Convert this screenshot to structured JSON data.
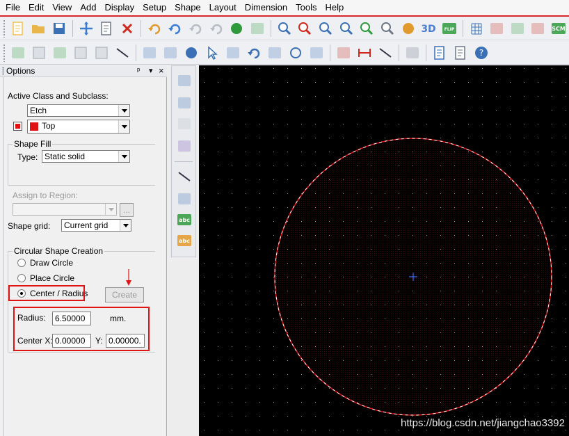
{
  "menu": [
    "File",
    "Edit",
    "View",
    "Add",
    "Display",
    "Setup",
    "Shape",
    "Layout",
    "Dimension",
    "Tools",
    "Help"
  ],
  "toolbar1": [
    {
      "icon": "new-file-icon",
      "color": "#f2c14e"
    },
    {
      "icon": "open-folder-icon",
      "color": "#e8b64a"
    },
    {
      "icon": "save-icon",
      "color": "#3b6fb6"
    },
    {
      "sep": true
    },
    {
      "icon": "move-icon",
      "color": "#3b7bd0"
    },
    {
      "icon": "copy-icon",
      "color": "#6d7785"
    },
    {
      "icon": "delete-icon",
      "color": "#d0281f"
    },
    {
      "sep": true
    },
    {
      "icon": "undo-icon",
      "color": "#e39a2c"
    },
    {
      "icon": "redo-down-icon",
      "color": "#3a7bd5"
    },
    {
      "icon": "redo-icon",
      "color": "#b8bdc5"
    },
    {
      "icon": "redo-down-disabled-icon",
      "color": "#b8bdc5"
    },
    {
      "icon": "green-sphere-icon",
      "color": "#2f9a3c"
    },
    {
      "icon": "pin-icon",
      "color": "#2f9a3c"
    },
    {
      "sep": true
    },
    {
      "icon": "zoom-points-icon",
      "color": "#3b6fb6"
    },
    {
      "icon": "zoom-fit-icon",
      "color": "#d0281f"
    },
    {
      "icon": "zoom-in-icon",
      "color": "#3b6fb6"
    },
    {
      "icon": "zoom-out-icon",
      "color": "#3b6fb6"
    },
    {
      "icon": "zoom-previous-icon",
      "color": "#2f9a3c"
    },
    {
      "icon": "zoom-world-icon",
      "color": "#6d7785"
    },
    {
      "icon": "redraw-icon",
      "color": "#e39a2c"
    },
    {
      "icon": "3d-icon",
      "color": "#4b7fd1",
      "text": "3D"
    },
    {
      "icon": "flip-icon",
      "color": "#2f9a3c",
      "text": "FLIP"
    },
    {
      "sep": true
    },
    {
      "icon": "grid-icon",
      "color": "#3b6fb6"
    },
    {
      "icon": "color-palette-icon",
      "color": "#d0281f"
    },
    {
      "icon": "layers-icon",
      "color": "#2f9a3c"
    },
    {
      "icon": "stackup-icon",
      "color": "#d0281f"
    },
    {
      "icon": "scm-icon",
      "color": "#2f9a3c",
      "text": "SCM"
    }
  ],
  "toolbar2": [
    {
      "icon": "place-green-icon",
      "color": "#2f9a3c"
    },
    {
      "icon": "disabled-box-icon",
      "color": "#b8bdc5"
    },
    {
      "icon": "green-arrow-box-icon",
      "color": "#2f9a3c"
    },
    {
      "icon": "disabled-box-icon",
      "color": "#b8bdc5"
    },
    {
      "icon": "disabled-box-icon",
      "color": "#b8bdc5"
    },
    {
      "icon": "green-outline-box-icon",
      "color": "#2f9a3c"
    },
    {
      "sep": true
    },
    {
      "icon": "shape-corner-icon",
      "color": "#3b6fb6"
    },
    {
      "icon": "rectangle-icon",
      "color": "#3b6fb6"
    },
    {
      "icon": "circle-icon",
      "color": "#3b6fb6"
    },
    {
      "icon": "select-pointer-icon",
      "color": "#3b6fb6"
    },
    {
      "icon": "merge-shapes-icon",
      "color": "#3b6fb6"
    },
    {
      "icon": "rotate-icon",
      "color": "#3b6fb6"
    },
    {
      "icon": "square-void-icon",
      "color": "#3b6fb6"
    },
    {
      "icon": "circle-void-icon",
      "color": "#3b6fb6"
    },
    {
      "icon": "polygon-void-icon",
      "color": "#3b6fb6"
    },
    {
      "sep": true
    },
    {
      "icon": "component-icon",
      "color": "#d0281f"
    },
    {
      "icon": "dimension-red-icon",
      "color": "#d0281f"
    },
    {
      "icon": "dimension-linear-icon",
      "color": "#d0281f"
    },
    {
      "sep": true
    },
    {
      "icon": "camera-icon",
      "color": "#6d7785"
    },
    {
      "sep": true
    },
    {
      "icon": "copy-window-icon",
      "color": "#3b6fb6"
    },
    {
      "icon": "message-icon",
      "color": "#6d7785"
    },
    {
      "icon": "help-icon",
      "color": "#3b6fb6"
    }
  ],
  "vertical_toolbar": [
    {
      "icon": "route-connect-icon",
      "color": "#3b6fb6"
    },
    {
      "icon": "slide-icon",
      "color": "#3b6fb6"
    },
    {
      "icon": "custom-smooth-icon",
      "color": "#b8bdc5"
    },
    {
      "icon": "fanout-icon",
      "color": "#7a55b8"
    },
    {
      "icon": "add-line-icon",
      "color": "#3b6fb6"
    },
    {
      "icon": "add-rect-icon",
      "color": "#3b6fb6"
    },
    {
      "icon": "add-text-icon",
      "color": "#2f9a3c",
      "text": "abc"
    },
    {
      "icon": "edit-text-icon",
      "color": "#e39a2c",
      "text": "abc"
    }
  ],
  "options": {
    "title": "Options",
    "pin": "ᵖ",
    "dropdown": "▾",
    "close": "×",
    "active_class_label": "Active Class and Subclass:",
    "class_value": "Etch",
    "subclass_value": "Top",
    "subclass_color": "#e01414",
    "shape_fill_legend": "Shape Fill",
    "type_label": "Type:",
    "type_value": "Static solid",
    "assign_region_label": "Assign to Region:",
    "assign_region_value": "",
    "browse_button": "...",
    "shape_grid_label": "Shape grid:",
    "shape_grid_value": "Current grid",
    "circular_legend": "Circular Shape Creation",
    "radio_draw": "Draw Circle",
    "radio_place": "Place Circle",
    "radio_center": "Center / Radius",
    "selected_mode": "Center / Radius",
    "create_button": "Create",
    "radius_label": "Radius:",
    "radius_value": "6.50000",
    "radius_unit": "mm.",
    "center_x_label": "Center X:",
    "center_x_value": "0.00000",
    "y_label": "Y:",
    "y_value": "0.00000."
  },
  "canvas": {
    "background": "#000000",
    "circle_outline": "#e01414",
    "circle_dash": "#ffffff",
    "crosshair": "#3a6df0",
    "grid_dot": "#9a9a9a"
  },
  "watermark": "https://blog.csdn.net/jiangchao3392"
}
